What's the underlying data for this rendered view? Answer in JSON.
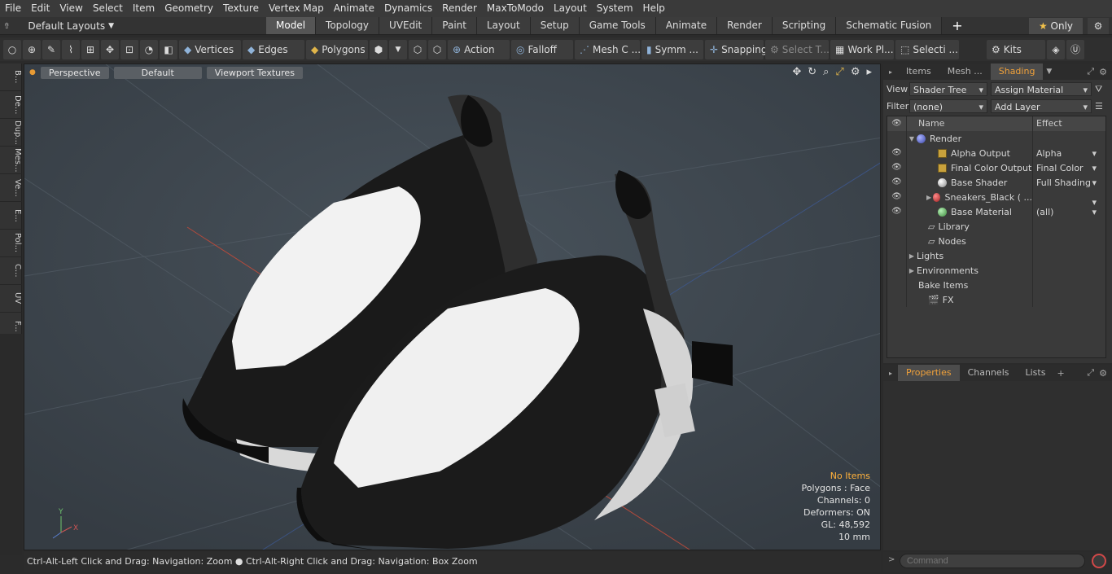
{
  "menu": [
    "File",
    "Edit",
    "View",
    "Select",
    "Item",
    "Geometry",
    "Texture",
    "Vertex Map",
    "Animate",
    "Dynamics",
    "Render",
    "MaxToModo",
    "Layout",
    "System",
    "Help"
  ],
  "layout_label": "Default Layouts",
  "tabs": [
    "Model",
    "Topology",
    "UVEdit",
    "Paint",
    "Layout",
    "Setup",
    "Game Tools",
    "Animate",
    "Render",
    "Scripting",
    "Schematic Fusion"
  ],
  "only_label": "Only",
  "toolbar": {
    "vertices": "Vertices",
    "edges": "Edges",
    "polygons": "Polygons",
    "action": "Action",
    "falloff": "Falloff",
    "mesh": "Mesh C ...",
    "symm": "Symm ...",
    "snapping": "Snapping",
    "select_t": "Select T...",
    "work_pl": "Work Pl...",
    "selecti": "Selecti ...",
    "kits": "Kits"
  },
  "left_tabs": [
    "B...",
    "De...",
    "Dup...",
    "Mes...",
    "Ve...",
    "E...",
    "Pol...",
    "C...",
    "UV",
    "F..."
  ],
  "viewport": {
    "perspective": "Perspective",
    "default": "Default",
    "textures": "Viewport Textures"
  },
  "stats": {
    "no_items": "No Items",
    "polygons": "Polygons : Face",
    "channels": "Channels: 0",
    "deformers": "Deformers: ON",
    "gl": "GL: 48,592",
    "scale": "10 mm"
  },
  "status": "Ctrl-Alt-Left Click and Drag: Navigation: Zoom ● Ctrl-Alt-Right Click and Drag: Navigation: Box Zoom",
  "right": {
    "tabs": [
      "Items",
      "Mesh ...",
      "Shading"
    ],
    "view_label": "View",
    "view_value": "Shader Tree",
    "assign": "Assign Material",
    "filter_label": "Filter",
    "filter_value": "(none)",
    "add_layer": "Add Layer",
    "col_name": "Name",
    "col_effect": "Effect"
  },
  "tree": [
    {
      "name": "Render",
      "effect": ""
    },
    {
      "name": "Alpha Output",
      "effect": "Alpha"
    },
    {
      "name": "Final Color Output",
      "effect": "Final Color"
    },
    {
      "name": "Base Shader",
      "effect": "Full Shading"
    },
    {
      "name": "Sneakers_Black ( ...",
      "effect": ""
    },
    {
      "name": "Base Material",
      "effect": "(all)"
    },
    {
      "name": "Library",
      "effect": ""
    },
    {
      "name": "Nodes",
      "effect": ""
    },
    {
      "name": "Lights",
      "effect": ""
    },
    {
      "name": "Environments",
      "effect": ""
    },
    {
      "name": "Bake Items",
      "effect": ""
    },
    {
      "name": "FX",
      "effect": ""
    }
  ],
  "props_tabs": [
    "Properties",
    "Channels",
    "Lists"
  ],
  "command_placeholder": "Command"
}
